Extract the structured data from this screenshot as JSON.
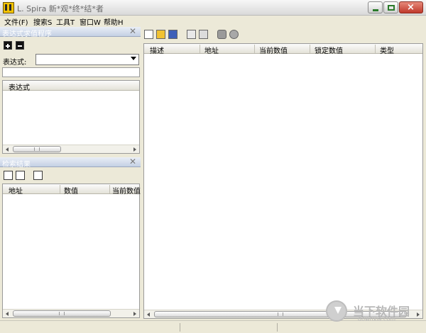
{
  "window": {
    "title": "L. Spira  新*观*终*结*者",
    "min_label": "",
    "max_label": "",
    "close_label": "×"
  },
  "menu": {
    "items": [
      {
        "label": "文件(F)"
      },
      {
        "label": "搜索S"
      },
      {
        "label": "工具T"
      },
      {
        "label": "窗口W"
      },
      {
        "label": "帮助H"
      }
    ]
  },
  "expression_panel": {
    "title": "表达式求值程序",
    "close": "✕",
    "field_label": "表达式:",
    "field_value": "",
    "list_header": "表达式",
    "scroll_grip": "|||"
  },
  "search_panel": {
    "title": "检索结果",
    "close": "✕",
    "columns": [
      "地址",
      "数值",
      "当前数值"
    ],
    "scroll_grip": "|||"
  },
  "main_table": {
    "columns": [
      "描述",
      "地址",
      "当前数值",
      "锁定数值",
      "类型"
    ],
    "scroll_grip": "|||"
  },
  "watermark": {
    "text": "当下软件园",
    "url": "downxia.com"
  }
}
